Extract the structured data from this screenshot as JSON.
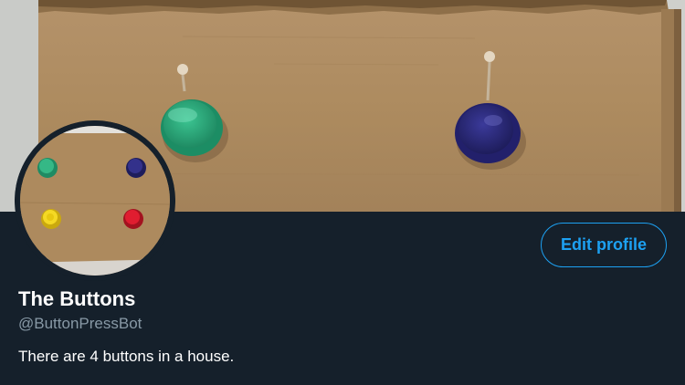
{
  "profile": {
    "display_name": "The Buttons",
    "handle": "@ButtonPressBot",
    "bio": "There are 4 buttons in a house.",
    "edit_button_label": "Edit profile"
  },
  "banner": {
    "description_icons": [
      "green-arcade-button-icon",
      "blue-arcade-button-icon"
    ]
  },
  "avatar": {
    "icons": [
      "green-button-icon",
      "blue-button-icon",
      "yellow-button-icon",
      "red-button-icon"
    ]
  },
  "colors": {
    "background": "#15202b",
    "accent": "#1da1f2",
    "secondary_text": "#8899a6",
    "cardboard": "#b08e63",
    "button_green": "#2fa77a",
    "button_blue": "#2c2a7a",
    "button_yellow": "#f2d21b",
    "button_red": "#d7192b"
  }
}
